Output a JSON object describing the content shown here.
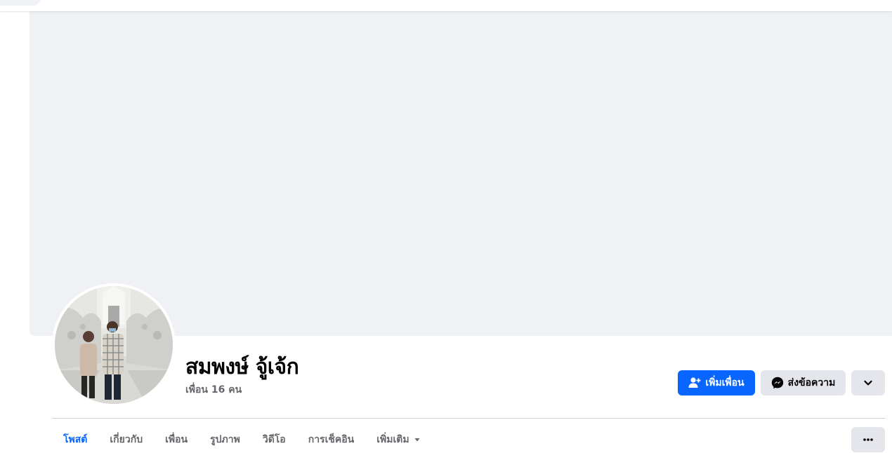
{
  "profile": {
    "name": "สมพงษ์ จู้เจ้ก",
    "friends_count": "เพื่อน 16 คน"
  },
  "actions": {
    "add_friend_label": "เพิ่มเพื่อน",
    "message_label": "ส่งข้อความ",
    "add_friend_icon": "person-add-icon",
    "message_icon": "messenger-icon",
    "more_icon": "chevron-down-icon"
  },
  "tabs": [
    {
      "label": "โพสต์",
      "active": true
    },
    {
      "label": "เกี่ยวกับ",
      "active": false
    },
    {
      "label": "เพื่อน",
      "active": false
    },
    {
      "label": "รูปภาพ",
      "active": false
    },
    {
      "label": "วิดีโอ",
      "active": false
    },
    {
      "label": "การเช็คอิน",
      "active": false
    },
    {
      "label": "เพิ่มเติม",
      "active": false
    }
  ],
  "colors": {
    "accent": "#0866ff",
    "secondary_button": "#e4e6eb",
    "cover": "#f0f1f5",
    "muted_text": "#65676b"
  }
}
